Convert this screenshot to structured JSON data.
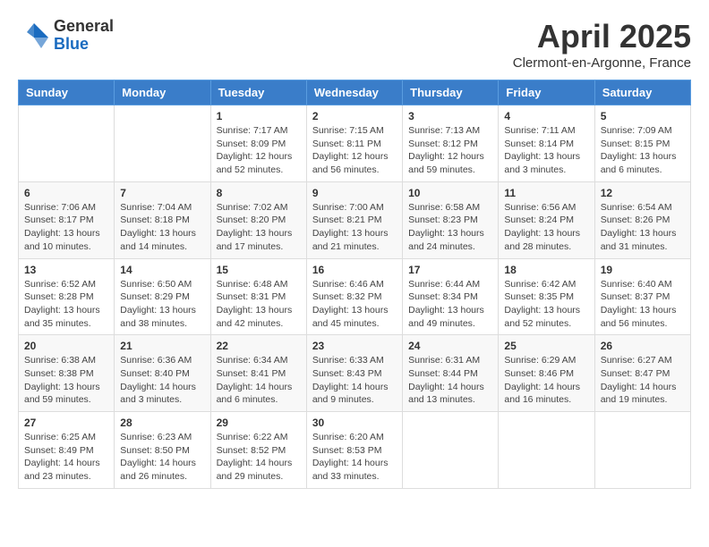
{
  "logo": {
    "general": "General",
    "blue": "Blue"
  },
  "title": "April 2025",
  "subtitle": "Clermont-en-Argonne, France",
  "days_header": [
    "Sunday",
    "Monday",
    "Tuesday",
    "Wednesday",
    "Thursday",
    "Friday",
    "Saturday"
  ],
  "weeks": [
    [
      {
        "day": "",
        "sunrise": "",
        "sunset": "",
        "daylight": ""
      },
      {
        "day": "",
        "sunrise": "",
        "sunset": "",
        "daylight": ""
      },
      {
        "day": "1",
        "sunrise": "Sunrise: 7:17 AM",
        "sunset": "Sunset: 8:09 PM",
        "daylight": "Daylight: 12 hours and 52 minutes."
      },
      {
        "day": "2",
        "sunrise": "Sunrise: 7:15 AM",
        "sunset": "Sunset: 8:11 PM",
        "daylight": "Daylight: 12 hours and 56 minutes."
      },
      {
        "day": "3",
        "sunrise": "Sunrise: 7:13 AM",
        "sunset": "Sunset: 8:12 PM",
        "daylight": "Daylight: 12 hours and 59 minutes."
      },
      {
        "day": "4",
        "sunrise": "Sunrise: 7:11 AM",
        "sunset": "Sunset: 8:14 PM",
        "daylight": "Daylight: 13 hours and 3 minutes."
      },
      {
        "day": "5",
        "sunrise": "Sunrise: 7:09 AM",
        "sunset": "Sunset: 8:15 PM",
        "daylight": "Daylight: 13 hours and 6 minutes."
      }
    ],
    [
      {
        "day": "6",
        "sunrise": "Sunrise: 7:06 AM",
        "sunset": "Sunset: 8:17 PM",
        "daylight": "Daylight: 13 hours and 10 minutes."
      },
      {
        "day": "7",
        "sunrise": "Sunrise: 7:04 AM",
        "sunset": "Sunset: 8:18 PM",
        "daylight": "Daylight: 13 hours and 14 minutes."
      },
      {
        "day": "8",
        "sunrise": "Sunrise: 7:02 AM",
        "sunset": "Sunset: 8:20 PM",
        "daylight": "Daylight: 13 hours and 17 minutes."
      },
      {
        "day": "9",
        "sunrise": "Sunrise: 7:00 AM",
        "sunset": "Sunset: 8:21 PM",
        "daylight": "Daylight: 13 hours and 21 minutes."
      },
      {
        "day": "10",
        "sunrise": "Sunrise: 6:58 AM",
        "sunset": "Sunset: 8:23 PM",
        "daylight": "Daylight: 13 hours and 24 minutes."
      },
      {
        "day": "11",
        "sunrise": "Sunrise: 6:56 AM",
        "sunset": "Sunset: 8:24 PM",
        "daylight": "Daylight: 13 hours and 28 minutes."
      },
      {
        "day": "12",
        "sunrise": "Sunrise: 6:54 AM",
        "sunset": "Sunset: 8:26 PM",
        "daylight": "Daylight: 13 hours and 31 minutes."
      }
    ],
    [
      {
        "day": "13",
        "sunrise": "Sunrise: 6:52 AM",
        "sunset": "Sunset: 8:28 PM",
        "daylight": "Daylight: 13 hours and 35 minutes."
      },
      {
        "day": "14",
        "sunrise": "Sunrise: 6:50 AM",
        "sunset": "Sunset: 8:29 PM",
        "daylight": "Daylight: 13 hours and 38 minutes."
      },
      {
        "day": "15",
        "sunrise": "Sunrise: 6:48 AM",
        "sunset": "Sunset: 8:31 PM",
        "daylight": "Daylight: 13 hours and 42 minutes."
      },
      {
        "day": "16",
        "sunrise": "Sunrise: 6:46 AM",
        "sunset": "Sunset: 8:32 PM",
        "daylight": "Daylight: 13 hours and 45 minutes."
      },
      {
        "day": "17",
        "sunrise": "Sunrise: 6:44 AM",
        "sunset": "Sunset: 8:34 PM",
        "daylight": "Daylight: 13 hours and 49 minutes."
      },
      {
        "day": "18",
        "sunrise": "Sunrise: 6:42 AM",
        "sunset": "Sunset: 8:35 PM",
        "daylight": "Daylight: 13 hours and 52 minutes."
      },
      {
        "day": "19",
        "sunrise": "Sunrise: 6:40 AM",
        "sunset": "Sunset: 8:37 PM",
        "daylight": "Daylight: 13 hours and 56 minutes."
      }
    ],
    [
      {
        "day": "20",
        "sunrise": "Sunrise: 6:38 AM",
        "sunset": "Sunset: 8:38 PM",
        "daylight": "Daylight: 13 hours and 59 minutes."
      },
      {
        "day": "21",
        "sunrise": "Sunrise: 6:36 AM",
        "sunset": "Sunset: 8:40 PM",
        "daylight": "Daylight: 14 hours and 3 minutes."
      },
      {
        "day": "22",
        "sunrise": "Sunrise: 6:34 AM",
        "sunset": "Sunset: 8:41 PM",
        "daylight": "Daylight: 14 hours and 6 minutes."
      },
      {
        "day": "23",
        "sunrise": "Sunrise: 6:33 AM",
        "sunset": "Sunset: 8:43 PM",
        "daylight": "Daylight: 14 hours and 9 minutes."
      },
      {
        "day": "24",
        "sunrise": "Sunrise: 6:31 AM",
        "sunset": "Sunset: 8:44 PM",
        "daylight": "Daylight: 14 hours and 13 minutes."
      },
      {
        "day": "25",
        "sunrise": "Sunrise: 6:29 AM",
        "sunset": "Sunset: 8:46 PM",
        "daylight": "Daylight: 14 hours and 16 minutes."
      },
      {
        "day": "26",
        "sunrise": "Sunrise: 6:27 AM",
        "sunset": "Sunset: 8:47 PM",
        "daylight": "Daylight: 14 hours and 19 minutes."
      }
    ],
    [
      {
        "day": "27",
        "sunrise": "Sunrise: 6:25 AM",
        "sunset": "Sunset: 8:49 PM",
        "daylight": "Daylight: 14 hours and 23 minutes."
      },
      {
        "day": "28",
        "sunrise": "Sunrise: 6:23 AM",
        "sunset": "Sunset: 8:50 PM",
        "daylight": "Daylight: 14 hours and 26 minutes."
      },
      {
        "day": "29",
        "sunrise": "Sunrise: 6:22 AM",
        "sunset": "Sunset: 8:52 PM",
        "daylight": "Daylight: 14 hours and 29 minutes."
      },
      {
        "day": "30",
        "sunrise": "Sunrise: 6:20 AM",
        "sunset": "Sunset: 8:53 PM",
        "daylight": "Daylight: 14 hours and 33 minutes."
      },
      {
        "day": "",
        "sunrise": "",
        "sunset": "",
        "daylight": ""
      },
      {
        "day": "",
        "sunrise": "",
        "sunset": "",
        "daylight": ""
      },
      {
        "day": "",
        "sunrise": "",
        "sunset": "",
        "daylight": ""
      }
    ]
  ]
}
